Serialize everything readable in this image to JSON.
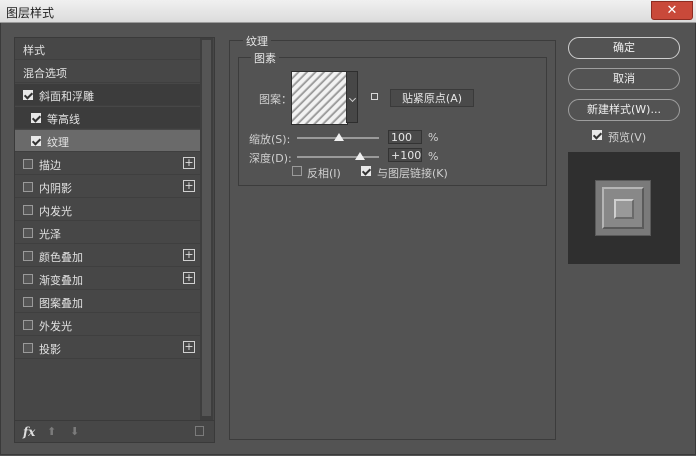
{
  "window": {
    "title": "图层样式",
    "close_glyph": "✕"
  },
  "styles_panel": {
    "items": [
      {
        "label": "样式"
      },
      {
        "label": "混合选项"
      },
      {
        "label": "斜面和浮雕"
      },
      {
        "label": "等高线"
      },
      {
        "label": "纹理"
      },
      {
        "label": "描边"
      },
      {
        "label": "内阴影"
      },
      {
        "label": "内发光"
      },
      {
        "label": "光泽"
      },
      {
        "label": "颜色叠加"
      },
      {
        "label": "渐变叠加"
      },
      {
        "label": "图案叠加"
      },
      {
        "label": "外发光"
      },
      {
        "label": "投影"
      }
    ],
    "fx_label": "fx",
    "plus_glyph": "+",
    "up_glyph": "⬆",
    "down_glyph": "⬇"
  },
  "texture": {
    "group_title": "纹理",
    "subgroup_title": "图素",
    "pattern_label": "图案：",
    "snap_button": "贴紧原点(A)",
    "scale_label": "缩放(S):",
    "scale_value": "100",
    "depth_label": "深度(D):",
    "depth_value": "+100",
    "percent": "%",
    "invert_label": "反相(I)",
    "link_label": "与图层链接(K)"
  },
  "actions": {
    "ok": "确定",
    "cancel": "取消",
    "new_style": "新建样式(W)...",
    "preview": "预览(V)"
  }
}
